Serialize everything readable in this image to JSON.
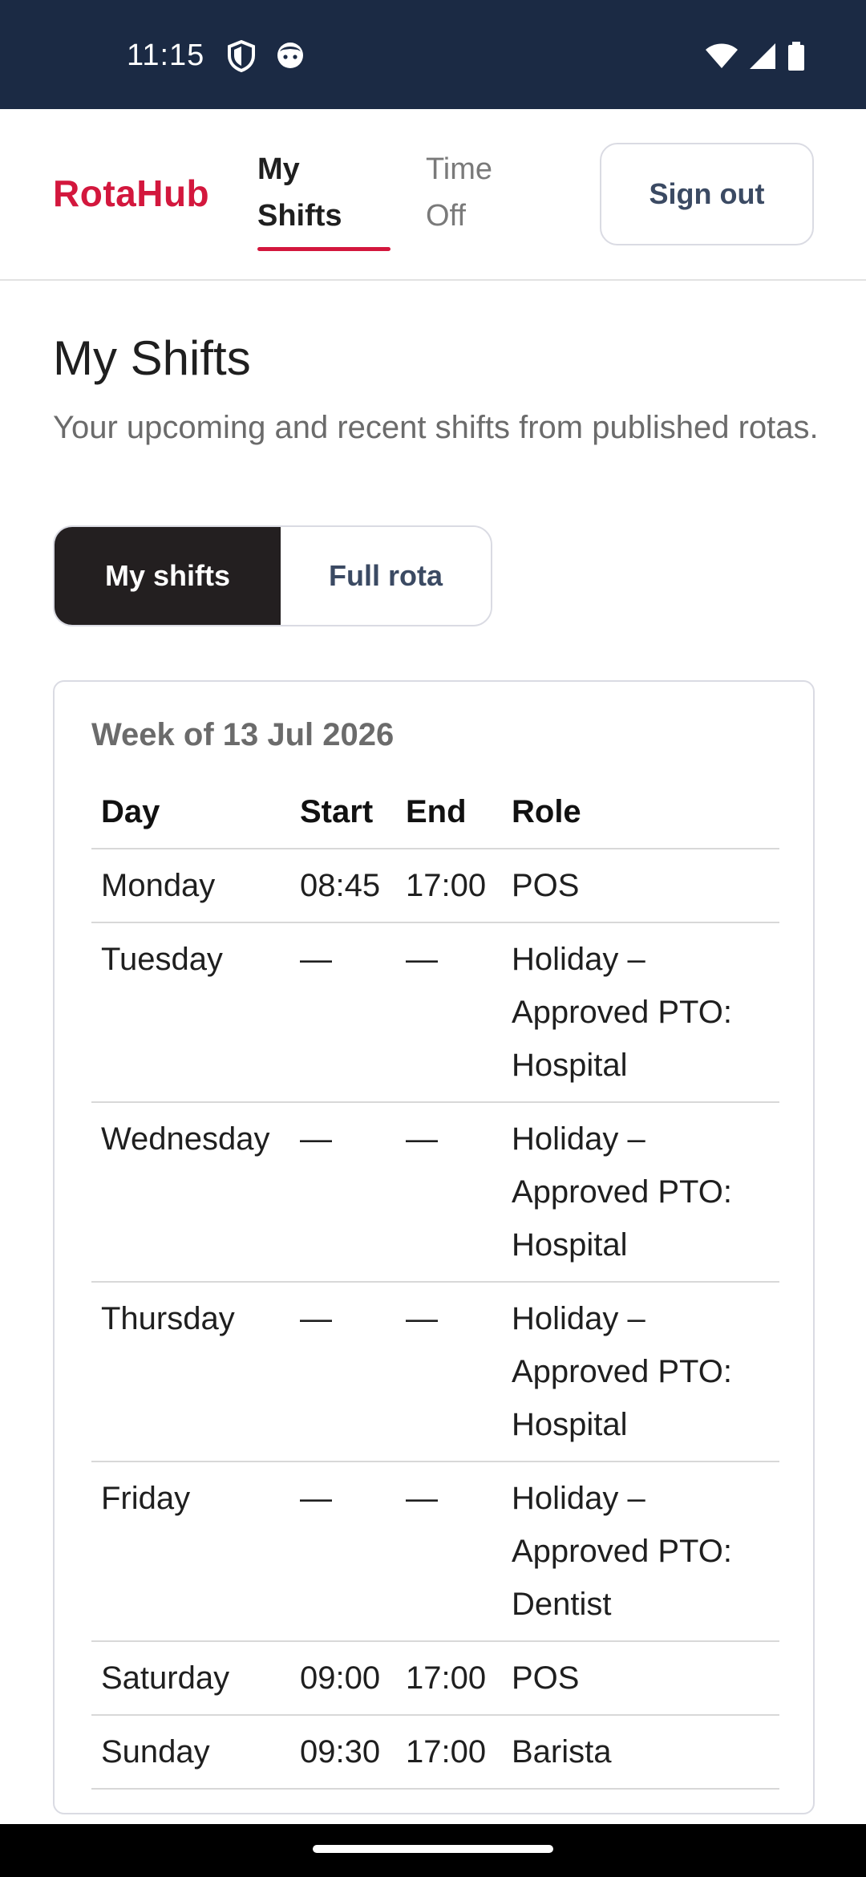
{
  "status_bar": {
    "time": "11:15",
    "left_icons": [
      "shield-icon",
      "face-icon"
    ],
    "right_icons": [
      "wifi-icon",
      "signal-icon",
      "battery-icon"
    ]
  },
  "header": {
    "logo": "RotaHub",
    "tabs": [
      {
        "label_line1": "My",
        "label_line2": "Shifts",
        "active": true
      },
      {
        "label_line1": "Time",
        "label_line2": "Off",
        "active": false
      }
    ],
    "sign_out_label": "Sign out"
  },
  "main": {
    "title": "My Shifts",
    "subtitle": "Your upcoming and recent shifts from published rotas.",
    "toggle": {
      "options": [
        "My shifts",
        "Full rota"
      ],
      "selected": "My shifts"
    },
    "week": {
      "heading": "Week of 13 Jul 2026",
      "columns": [
        "Day",
        "Start",
        "End",
        "Role"
      ],
      "rows": [
        {
          "day": "Monday",
          "start": "08:45",
          "end": "17:00",
          "role": "POS"
        },
        {
          "day": "Tuesday",
          "start": "—",
          "end": "—",
          "role": "Holiday – Approved PTO: Hospital"
        },
        {
          "day": "Wednesday",
          "start": "—",
          "end": "—",
          "role": "Holiday – Approved PTO: Hospital"
        },
        {
          "day": "Thursday",
          "start": "—",
          "end": "—",
          "role": "Holiday – Approved PTO: Hospital"
        },
        {
          "day": "Friday",
          "start": "—",
          "end": "—",
          "role": "Holiday – Approved PTO: Dentist"
        },
        {
          "day": "Saturday",
          "start": "09:00",
          "end": "17:00",
          "role": "POS"
        },
        {
          "day": "Sunday",
          "start": "09:30",
          "end": "17:00",
          "role": "Barista"
        }
      ]
    }
  },
  "colors": {
    "brand": "#d3173d",
    "status_bar": "#1b2a44",
    "toggle_active": "#231f20"
  }
}
